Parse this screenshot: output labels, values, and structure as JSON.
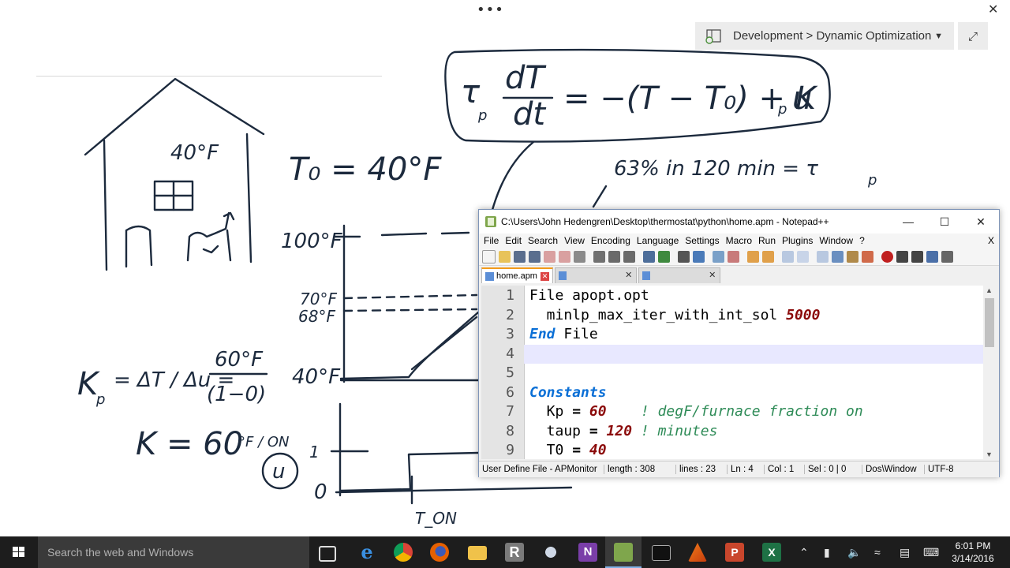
{
  "header": {
    "more_glyph": "•••",
    "close_glyph": "✕",
    "section_label": "Development > Dynamic Optimization",
    "section_chevron": "▼",
    "expand_glyph": "⤢"
  },
  "notes": {
    "house_temp": "40°F",
    "t0_eq": "T₀ = 40°F",
    "pde_lhs": "τ",
    "pde_frac_top": "dT",
    "pde_frac_bottom": "dt",
    "pde_rhs": "= −(T − T₀) + K",
    "pde_u": "u",
    "sub_p": "p",
    "time_const": "63% in 120 min = τ",
    "y_100": "100°F",
    "y_70": "70°F",
    "y_68": "68°F",
    "y_40": "40°F",
    "kp_eq_left": "K",
    "kp_eq_mid": "= ΔT / Δu =",
    "kp_frac_top": "60°F",
    "kp_frac_bottom": "(1−0)",
    "kp_eq2": "K   = 60",
    "kp_eq2_unit": "°F / ON",
    "u_label": "u",
    "u_1": "1",
    "u_0": "0",
    "t_on": "T_ON"
  },
  "notepad": {
    "title": "C:\\Users\\John Hedengren\\Desktop\\thermostat\\python\\home.apm - Notepad++",
    "menu": [
      "File",
      "Edit",
      "Search",
      "View",
      "Encoding",
      "Language",
      "Settings",
      "Macro",
      "Run",
      "Plugins",
      "Window",
      "?"
    ],
    "menu_close": "X",
    "tabs": [
      {
        "label": "home.apm",
        "active": true
      },
      {
        "label": "",
        "active": false
      },
      {
        "label": "",
        "active": false
      }
    ],
    "lines": [
      {
        "n": "1",
        "segs": [
          {
            "c": "",
            "t": "File apopt.opt"
          }
        ]
      },
      {
        "n": "2",
        "segs": [
          {
            "c": "",
            "t": "  minlp_max_iter_with_int_sol "
          },
          {
            "c": "num-lit",
            "t": "5000"
          }
        ]
      },
      {
        "n": "3",
        "segs": [
          {
            "c": "kw",
            "t": "End"
          },
          {
            "c": "",
            "t": " File"
          }
        ]
      },
      {
        "n": "4",
        "segs": []
      },
      {
        "n": "5",
        "segs": []
      },
      {
        "n": "6",
        "segs": [
          {
            "c": "kw",
            "t": "Constants"
          }
        ]
      },
      {
        "n": "7",
        "segs": [
          {
            "c": "",
            "t": "  Kp "
          },
          {
            "c": "op",
            "t": "="
          },
          {
            "c": "",
            "t": " "
          },
          {
            "c": "num-lit",
            "t": "60"
          },
          {
            "c": "",
            "t": "    "
          },
          {
            "c": "cm",
            "t": "! degF/furnace fraction on"
          }
        ]
      },
      {
        "n": "8",
        "segs": [
          {
            "c": "",
            "t": "  taup "
          },
          {
            "c": "op",
            "t": "="
          },
          {
            "c": "",
            "t": " "
          },
          {
            "c": "num-lit",
            "t": "120"
          },
          {
            "c": "",
            "t": " "
          },
          {
            "c": "cm",
            "t": "! minutes"
          }
        ]
      },
      {
        "n": "9",
        "segs": [
          {
            "c": "",
            "t": "  T0 "
          },
          {
            "c": "op",
            "t": "="
          },
          {
            "c": "",
            "t": " "
          },
          {
            "c": "num-lit",
            "t": "40"
          }
        ]
      }
    ],
    "current_line": 4,
    "status": {
      "lang": "User Define File - APMonitor",
      "length": "length : 308",
      "lines": "lines : 23",
      "ln": "Ln : 4",
      "col": "Col : 1",
      "sel": "Sel : 0 | 0",
      "eol": "Dos\\Window",
      "enc": "UTF-8"
    }
  },
  "taskbar": {
    "search_placeholder": "Search the web and Windows",
    "time": "6:01 PM",
    "date": "3/14/2016"
  },
  "colors": {
    "ink": "#1c2a3d",
    "npp_accent": "#f29a1a",
    "taskbar": "#1d1d1d"
  }
}
